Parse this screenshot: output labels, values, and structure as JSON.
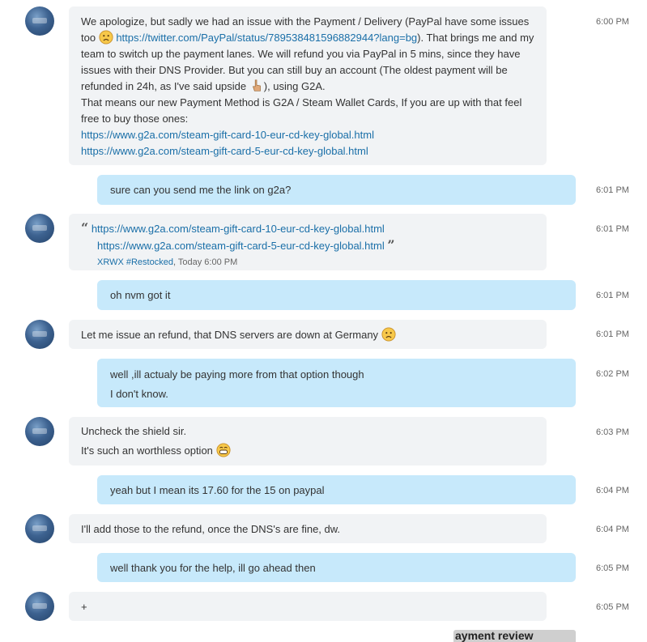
{
  "messages": [
    {
      "times": "6:00 PM",
      "part1": "We apologize, but sadly we had an issue with the Payment / Delivery (PayPal have some issues too ",
      "link1": "https://twitter.com/PayPal/status/789538481596882944?lang=bg",
      "part2": "). That brings me and my team to switch up the payment lanes. We will refund you via PayPal in 5 mins, since they have issues with their DNS Provider. But you can still buy an account (The oldest payment will be refunded in 24h, as I've said upside ",
      "part3": "), using G2A.",
      "part4": "That means our new Payment Method is G2A / Steam Wallet Cards, If you are up with that feel free to buy those ones:",
      "link2": "https://www.g2a.com/steam-gift-card-10-eur-cd-key-global.html",
      "link3": "https://www.g2a.com/steam-gift-card-5-eur-cd-key-global.html"
    },
    {
      "time": "6:01 PM",
      "text": "sure can you send me the link on g2a?"
    },
    {
      "time": "6:01 PM",
      "quote_open": "“",
      "link1": "https://www.g2a.com/steam-gift-card-10-eur-cd-key-global.html",
      "link2": "https://www.g2a.com/steam-gift-card-5-eur-cd-key-global.html",
      "quote_close": "”",
      "author": "XRWX #Restocked",
      "when": ", Today 6:00 PM"
    },
    {
      "time": "6:01 PM",
      "text": "oh nvm got it"
    },
    {
      "time": "6:01 PM",
      "text": "Let me issue an refund, that DNS servers are down at Germany "
    },
    {
      "time": "6:02 PM",
      "line1": "well ,ill actualy be paying more from that option though",
      "line2": "I don't know."
    },
    {
      "time": "6:03 PM",
      "line1": "Uncheck the shield sir.",
      "line2": "It's such an worthless option "
    },
    {
      "time": "6:04 PM",
      "text": "yeah but I mean its 17.60 for the 15 on paypal"
    },
    {
      "time": "6:04 PM",
      "text": "I'll add those to the refund, once the DNS's are fine, dw."
    },
    {
      "time": "6:05 PM",
      "text": "well thank you for the help, ill go ahead then"
    },
    {
      "time": "6:05 PM",
      "text": "+"
    }
  ],
  "footer_clip": "ayment review",
  "icons": [
    "sad-emoji-icon",
    "pointing-hand-icon",
    "grin-emoji-icon"
  ],
  "colors": {
    "incoming_bubble": "#f1f3f5",
    "outgoing_bubble": "#c7e9fb",
    "link": "#1a6fa8"
  }
}
